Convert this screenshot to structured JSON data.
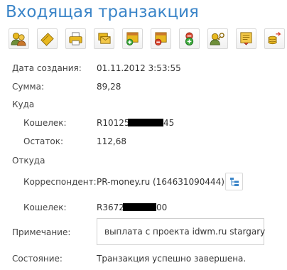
{
  "page": {
    "title": "Входящая транзакция"
  },
  "toolbar": {
    "buttons": [
      {
        "icon": "users-icon"
      },
      {
        "icon": "wallet-icon"
      },
      {
        "icon": "printer-icon"
      },
      {
        "icon": "envelope-icon"
      },
      {
        "icon": "wallet-add-icon"
      },
      {
        "icon": "wallet-remove-icon"
      },
      {
        "icon": "add-circle-icon"
      },
      {
        "icon": "user-key-icon"
      },
      {
        "icon": "certificate-icon"
      },
      {
        "icon": "money-transfer-icon"
      }
    ]
  },
  "details": {
    "created_label": "Дата создания:",
    "created_value": "01.11.2012 3:53:55",
    "amount_label": "Сумма:",
    "amount_value": "89,28",
    "to_section": "Куда",
    "to_wallet_label": "Кошелек:",
    "to_wallet_prefix": "R10125",
    "to_wallet_suffix": "45",
    "balance_label": "Остаток:",
    "balance_value": "112,68",
    "from_section": "Откуда",
    "correspondent_label": "Корреспондент:",
    "correspondent_value": "PR-money.ru (164631090444)",
    "from_wallet_label": "Кошелек:",
    "from_wallet_prefix": "R3672",
    "from_wallet_suffix": "00",
    "note_label": "Примечание:",
    "note_value": "выплата с проекта idwm.ru stargary",
    "status_label": "Состояние:",
    "status_value": "Транзакция успешно завершена."
  },
  "colors": {
    "title": "#3b85c8",
    "text": "#444444",
    "icon_gold": "#e8b820",
    "icon_green": "#3aa83a",
    "icon_red": "#d9432c",
    "icon_blue": "#3b85c8"
  }
}
